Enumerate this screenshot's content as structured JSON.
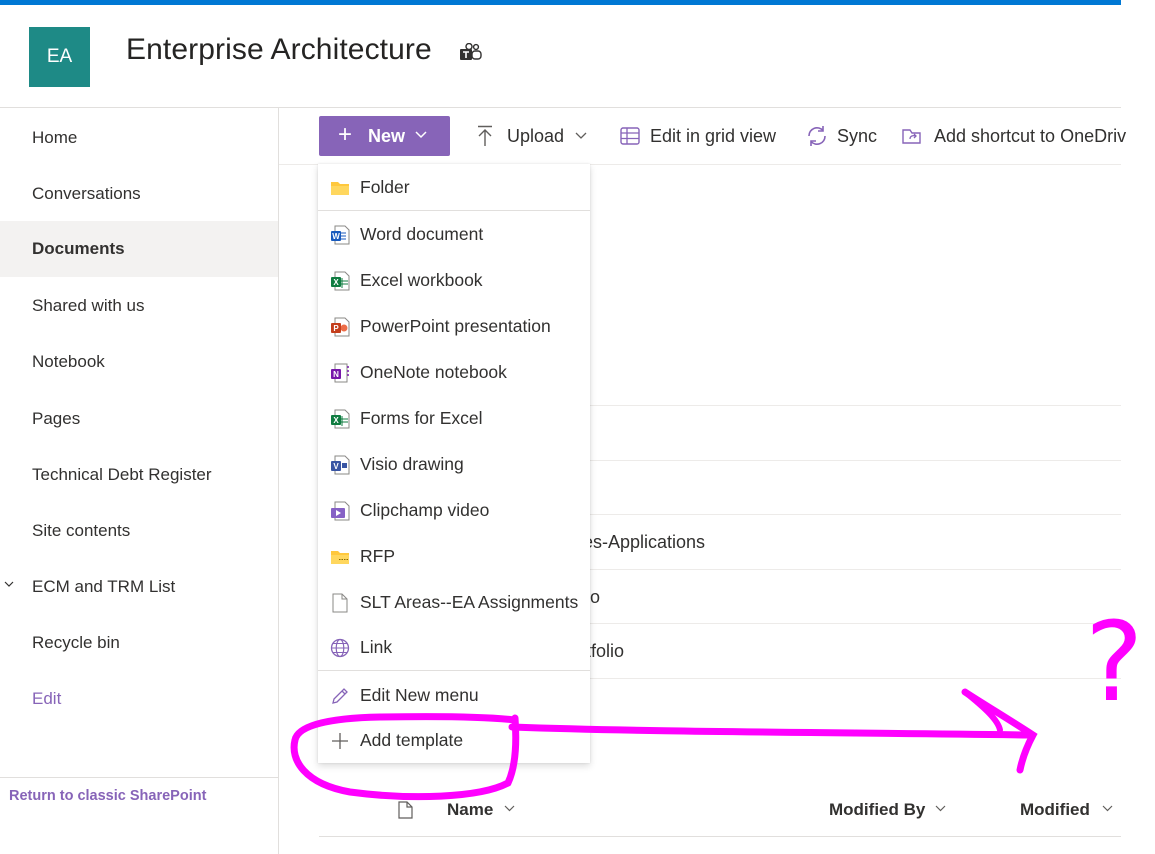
{
  "header": {
    "logo_text": "EA",
    "site_title": "Enterprise Architecture",
    "teams_icon": "teams-icon"
  },
  "sidebar": {
    "items": [
      {
        "label": "Home"
      },
      {
        "label": "Conversations"
      },
      {
        "label": "Documents",
        "active": true
      },
      {
        "label": "Shared with us"
      },
      {
        "label": "Notebook"
      },
      {
        "label": "Pages"
      },
      {
        "label": "Technical Debt Register"
      },
      {
        "label": "Site contents"
      },
      {
        "label": "ECM and TRM List",
        "expandable": true
      },
      {
        "label": "Recycle bin"
      },
      {
        "label": "Edit"
      }
    ],
    "return_link": "Return to classic SharePoint"
  },
  "commandbar": {
    "new_label": "New",
    "upload_label": "Upload",
    "grid_label": "Edit in grid view",
    "sync_label": "Sync",
    "shortcut_label": "Add shortcut to OneDriv"
  },
  "new_menu": {
    "items": [
      {
        "label": "Folder",
        "icon": "folder-icon"
      },
      {
        "label": "Word document",
        "icon": "word-icon"
      },
      {
        "label": "Excel workbook",
        "icon": "excel-icon"
      },
      {
        "label": "PowerPoint presentation",
        "icon": "powerpoint-icon"
      },
      {
        "label": "OneNote notebook",
        "icon": "onenote-icon"
      },
      {
        "label": "Forms for Excel",
        "icon": "forms-excel-icon"
      },
      {
        "label": "Visio drawing",
        "icon": "visio-icon"
      },
      {
        "label": "Clipchamp video",
        "icon": "clipchamp-icon"
      },
      {
        "label": "RFP",
        "icon": "rfp-folder-icon"
      },
      {
        "label": "SLT Areas--EA Assignments",
        "icon": "document-icon"
      },
      {
        "label": "Link",
        "icon": "globe-icon"
      },
      {
        "label": "Edit New menu",
        "icon": "pencil-icon"
      },
      {
        "label": "Add template",
        "icon": "plus-icon"
      }
    ]
  },
  "background_rows": {
    "row1": "ies-Applications",
    "row2": "o",
    "row3": "rtfolio"
  },
  "list_header": {
    "name_label": "Name",
    "modified_by_label": "Modified By",
    "modified_label": "Modified"
  },
  "annotation": {
    "question_mark": "?",
    "color": "#ff00ff"
  },
  "colors": {
    "accent": "#8764b8",
    "top_bar": "#0078d4",
    "logo_bg": "#1e8a86"
  }
}
